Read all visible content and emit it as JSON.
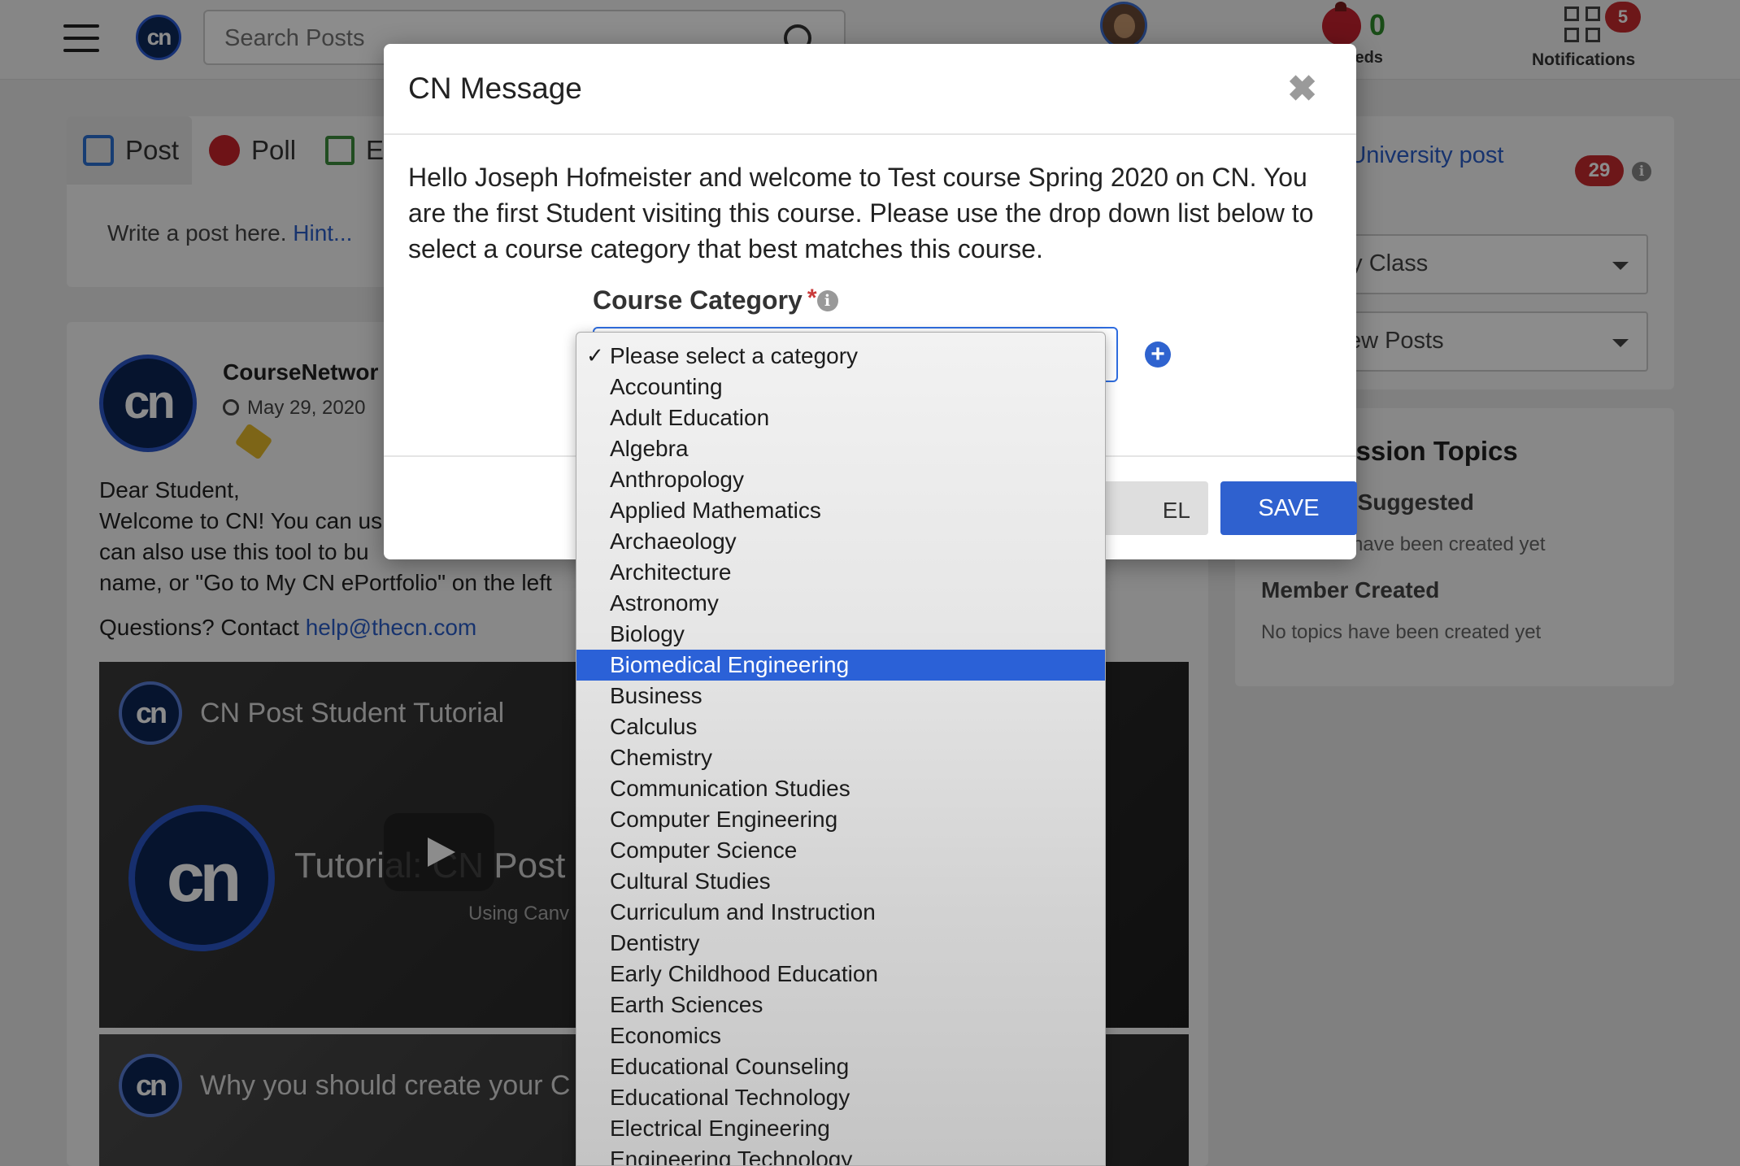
{
  "topbar": {
    "search_placeholder": "Search Posts",
    "seeds_count": "0",
    "seeds_label": "Seeds",
    "notifications_count": "5",
    "notifications_label": "Notifications"
  },
  "composer": {
    "tabs": [
      {
        "label": "Post"
      },
      {
        "label": "Poll"
      },
      {
        "label": "Ev"
      }
    ],
    "hint_text": "Write a post here. ",
    "hint_link": "Hint..."
  },
  "feed": {
    "author": "CourseNetwor",
    "date": "May 29, 2020",
    "body_lines": [
      "Dear Student,",
      "Welcome to CN! You can us",
      "can also use this tool to bu",
      "name, or \"Go to My CN ePortfolio\" on the left"
    ],
    "contact_prefix": "Questions? Contact ",
    "contact_email": "help@thecn.com",
    "video1_title": "CN Post Student Tutorial",
    "video1_subtitle": "Tutorial: CN Post (fo",
    "video1_caption": "Using Canv",
    "video2_title": "Why you should create your C"
  },
  "sidebar": {
    "university_link": "na University post",
    "post_count": "29",
    "select1": "My Class",
    "select2": "New Posts",
    "discussion_title": "cussion Topics",
    "suggested_title": "r Suggested",
    "suggested_text": "have been created yet",
    "member_title": "Member Created",
    "member_text": "No topics have been created yet"
  },
  "modal": {
    "title": "CN Message",
    "close_glyph": "✖",
    "message": "Hello Joseph Hofmeister and welcome to Test course Spring 2020 on CN. You are the first Student visiting this course. Please use the drop down list below to select a course category that best matches this course.",
    "category_label": "Course Category",
    "required_mark": "*",
    "cancel_label": "EL",
    "save_label": "SAVE"
  },
  "dropdown": {
    "checked_index": 0,
    "highlighted_index": 10,
    "options": [
      "Please select a category",
      "Accounting",
      "Adult Education",
      "Algebra",
      "Anthropology",
      "Applied Mathematics",
      "Archaeology",
      "Architecture",
      "Astronomy",
      "Biology",
      "Biomedical Engineering",
      "Business",
      "Calculus",
      "Chemistry",
      "Communication Studies",
      "Computer Engineering",
      "Computer Science",
      "Cultural Studies",
      "Curriculum and Instruction",
      "Dentistry",
      "Early Childhood Education",
      "Earth Sciences",
      "Economics",
      "Educational Counseling",
      "Educational Technology",
      "Electrical Engineering",
      "Engineering Technology"
    ]
  },
  "colors": {
    "accent": "#2f61cf",
    "highlight": "#2b61d7",
    "badge": "#c62a2f"
  }
}
